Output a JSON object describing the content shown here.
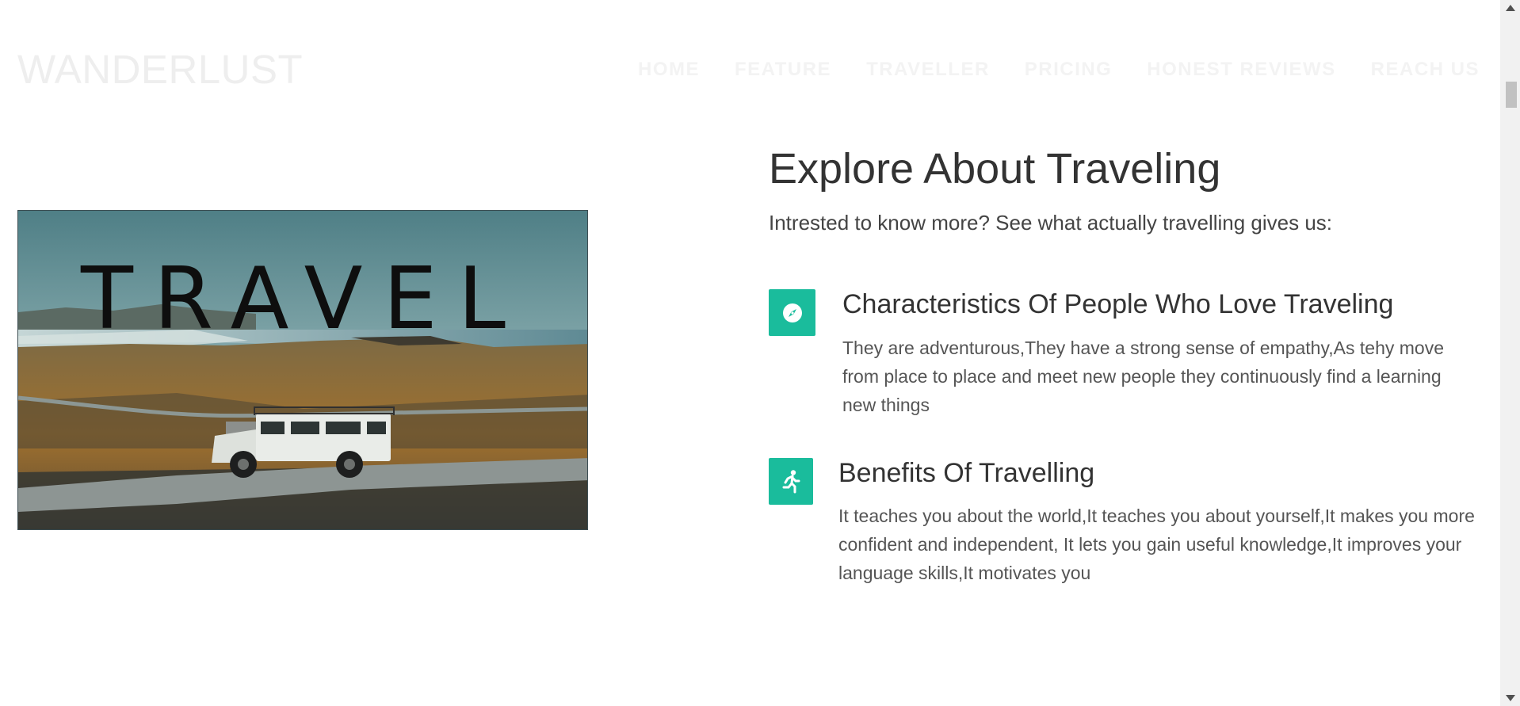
{
  "header": {
    "brand": "WANDERLUST",
    "nav": [
      {
        "label": "HOME"
      },
      {
        "label": "FEATURE"
      },
      {
        "label": "TRAVELLER"
      },
      {
        "label": "PRICING"
      },
      {
        "label": "HONEST REVIEWS"
      },
      {
        "label": "REACH US"
      }
    ]
  },
  "hero": {
    "image_text": "TRAVEL"
  },
  "about": {
    "title": "Explore About Traveling",
    "subtitle": "Intrested to know more? See what actually travelling gives us:",
    "features": [
      {
        "icon": "compass-icon",
        "title": "Characteristics Of People Who Love Traveling",
        "text": "They are adventurous,They have a strong sense of empathy,As tehy move from place to place and meet new people they continuously find a learning new things"
      },
      {
        "icon": "running-person-icon",
        "title": "Benefits Of Travelling",
        "text": "It teaches you about the world,It teaches you about yourself,It makes you more confident and independent, It lets you gain useful knowledge,It improves your language skills,It motivates you"
      }
    ]
  },
  "colors": {
    "accent": "#1abc9c",
    "heading": "#333333",
    "body_text": "#555555"
  }
}
